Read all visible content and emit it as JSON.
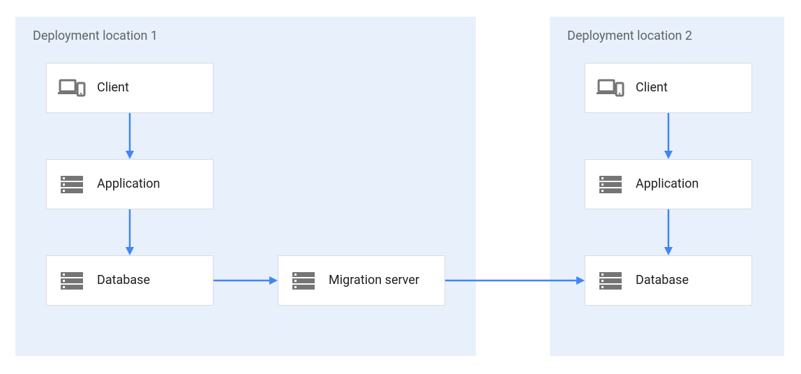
{
  "regions": {
    "loc1": {
      "title": "Deployment location 1"
    },
    "loc2": {
      "title": "Deployment location 2"
    }
  },
  "nodes": {
    "client1": {
      "label": "Client"
    },
    "app1": {
      "label": "Application"
    },
    "db1": {
      "label": "Database"
    },
    "migration": {
      "label": "Migration server"
    },
    "client2": {
      "label": "Client"
    },
    "app2": {
      "label": "Application"
    },
    "db2": {
      "label": "Database"
    }
  },
  "arrows": [
    {
      "from": "client1",
      "to": "app1"
    },
    {
      "from": "app1",
      "to": "db1"
    },
    {
      "from": "db1",
      "to": "migration"
    },
    {
      "from": "migration",
      "to": "db2"
    },
    {
      "from": "client2",
      "to": "app2"
    },
    {
      "from": "app2",
      "to": "db2"
    }
  ],
  "colors": {
    "region_bg": "#e8f0fb",
    "node_border": "#dadce0",
    "arrow": "#4285f4",
    "icon": "#757575"
  }
}
